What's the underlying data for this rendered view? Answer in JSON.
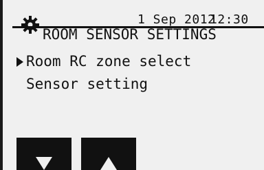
{
  "header": {
    "date": "1 Sep 2012",
    "time": "12:30",
    "title": "ROOM SENSOR SETTINGS",
    "icon": "gear-icon"
  },
  "menu": {
    "items": [
      {
        "label": "Room RC zone select",
        "selected": true
      },
      {
        "label": "Sensor setting",
        "selected": false
      }
    ]
  },
  "buttons": {
    "down_icon": "down-arrow-icon",
    "up_icon": "up-arrow-icon"
  }
}
